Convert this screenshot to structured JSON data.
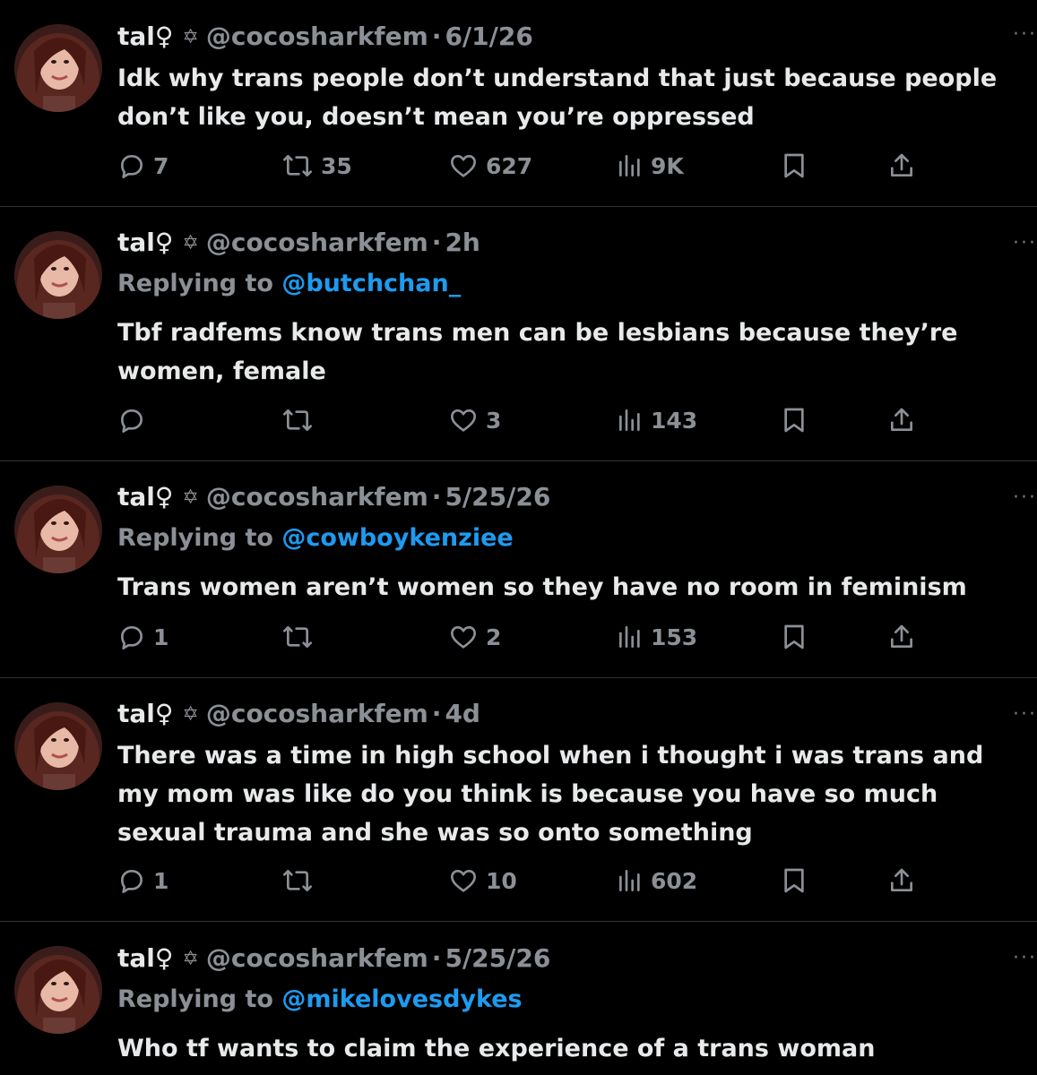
{
  "tweets": [
    {
      "name": "tal",
      "handle": "@cocosharkfem",
      "dot": "·",
      "time": "6/1/26",
      "replying_prefix": "",
      "replying_to": "",
      "text": "Idk why trans people don’t understand that just because people don’t like you, doesn’t mean you’re oppressed",
      "replies": "7",
      "reposts": "35",
      "likes": "627",
      "views": "9K"
    },
    {
      "name": "tal",
      "handle": "@cocosharkfem",
      "dot": "·",
      "time": "2h",
      "replying_prefix": "Replying to",
      "replying_to": "@butchchan_",
      "text": "Tbf radfems know trans men can be lesbians because they’re women, female",
      "replies": "",
      "reposts": "",
      "likes": "3",
      "views": "143"
    },
    {
      "name": "tal",
      "handle": "@cocosharkfem",
      "dot": "·",
      "time": "5/25/26",
      "replying_prefix": "Replying to",
      "replying_to": "@cowboykenziee",
      "text": "Trans women aren’t women so they have no room in feminism",
      "replies": "1",
      "reposts": "",
      "likes": "2",
      "views": "153"
    },
    {
      "name": "tal",
      "handle": "@cocosharkfem",
      "dot": "·",
      "time": "4d",
      "replying_prefix": "",
      "replying_to": "",
      "text": "There was a time in high school when i thought i was trans and my mom was like do you think is because you have so much sexual trauma and she was so onto something",
      "replies": "1",
      "reposts": "",
      "likes": "10",
      "views": "602"
    },
    {
      "name": "tal",
      "handle": "@cocosharkfem",
      "dot": "·",
      "time": "5/25/26",
      "replying_prefix": "Replying to",
      "replying_to": "@mikelovesdykes",
      "text": "Who tf wants to claim the experience of a trans woman",
      "replies": "",
      "reposts": "",
      "likes": "",
      "views": ""
    }
  ],
  "symbols": {
    "venus": "♀",
    "star": "✡",
    "more": "···"
  },
  "colors": {
    "background": "#000000",
    "text": "#e7e9ea",
    "secondary": "#8b9096",
    "mention": "#1d9bf0",
    "divider": "#2f3336"
  },
  "icons": [
    "reply-icon",
    "repost-icon",
    "like-icon",
    "views-icon",
    "bookmark-icon",
    "share-icon",
    "more-icon",
    "star-of-david-icon"
  ]
}
